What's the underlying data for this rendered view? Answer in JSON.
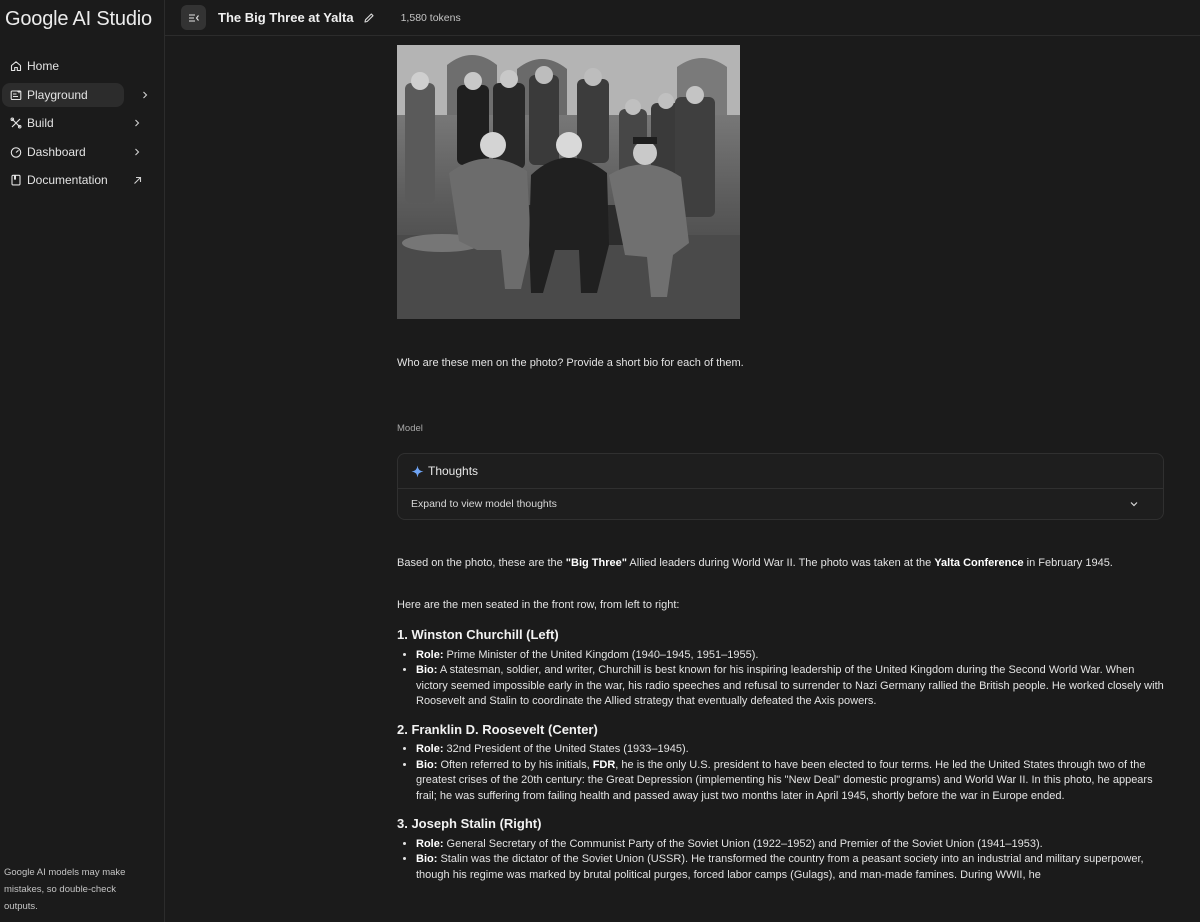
{
  "app": {
    "logo": "Google AI Studio",
    "disclaimer": "Google AI models may make mistakes, so double-check outputs."
  },
  "sidebar": {
    "items": [
      {
        "label": "Home",
        "icon": "home-icon"
      },
      {
        "label": "Playground",
        "icon": "playground-icon",
        "active": true
      },
      {
        "label": "Build",
        "icon": "build-icon"
      },
      {
        "label": "Dashboard",
        "icon": "dashboard-icon"
      },
      {
        "label": "Documentation",
        "icon": "documentation-icon"
      }
    ]
  },
  "topbar": {
    "title": "The Big Three at Yalta",
    "tokens": "1,580 tokens"
  },
  "chat": {
    "prompt": "Who are these men on the photo? Provide a short bio for each of them.",
    "model_label": "Model",
    "thoughts": {
      "title": "Thoughts",
      "expand": "Expand to view model thoughts"
    },
    "answer": {
      "intro_1": "Based on the photo, these are the ",
      "intro_b1": "\"Big Three\"",
      "intro_2": " Allied leaders during World War II. The photo was taken at the ",
      "intro_b2": "Yalta Conference",
      "intro_3": " in February 1945.",
      "rows_line": "Here are the men seated in the front row, from left to right:",
      "role_label": "Role:",
      "bio_label": "Bio:",
      "people": [
        {
          "heading": "1. Winston Churchill (Left)",
          "role": " Prime Minister of the United Kingdom (1940–1945, 1951–1955).",
          "bio": " A statesman, soldier, and writer, Churchill is best known for his inspiring leadership of the United Kingdom during the Second World War. When victory seemed impossible early in the war, his radio speeches and refusal to surrender to Nazi Germany rallied the British people. He worked closely with Roosevelt and Stalin to coordinate the Allied strategy that eventually defeated the Axis powers."
        },
        {
          "heading": "2. Franklin D. Roosevelt (Center)",
          "role": " 32nd President of the United States (1933–1945).",
          "bio_1": " Often referred to by his initials, ",
          "bio_b": "FDR",
          "bio_2": ", he is the only U.S. president to have been elected to four terms. He led the United States through two of the greatest crises of the 20th century: the Great Depression (implementing his \"New Deal\" domestic programs) and World War II. In this photo, he appears frail; he was suffering from failing health and passed away just two months later in April 1945, shortly before the war in Europe ended."
        },
        {
          "heading": "3. Joseph Stalin (Right)",
          "role": " General Secretary of the Communist Party of the Soviet Union (1922–1952) and Premier of the Soviet Union (1941–1953).",
          "bio": " Stalin was the dictator of the Soviet Union (USSR). He transformed the country from a peasant society into an industrial and military superpower, though his regime was marked by brutal political purges, forced labor camps (Gulags), and man-made famines. During WWII, he"
        }
      ]
    }
  }
}
